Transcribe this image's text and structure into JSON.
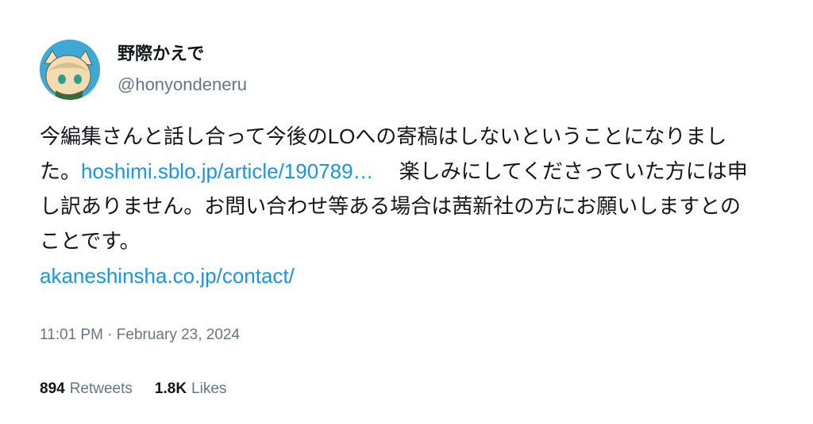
{
  "user": {
    "display_name": "野際かえで",
    "handle": "@honyondeneru",
    "avatar_icon": "anime-character-avatar"
  },
  "tweet": {
    "text_part1": "今編集さんと話し合って今後のLOへの寄稿はしないということになりました。",
    "link1": "hoshimi.sblo.jp/article/190789…",
    "text_part2": "楽しみにしてくださっていた方には申し訳ありません。お問い合わせ等ある場合は茜新社の方にお願いしますとのことです。",
    "link2": "akaneshinsha.co.jp/contact/",
    "timestamp": "11:01 PM · February 23, 2024"
  },
  "stats": {
    "retweets_count": "894",
    "retweets_label": "Retweets",
    "likes_count": "1.8K",
    "likes_label": "Likes"
  },
  "colors": {
    "link": "#1b95e0",
    "muted": "#657786",
    "text": "#14171a"
  }
}
